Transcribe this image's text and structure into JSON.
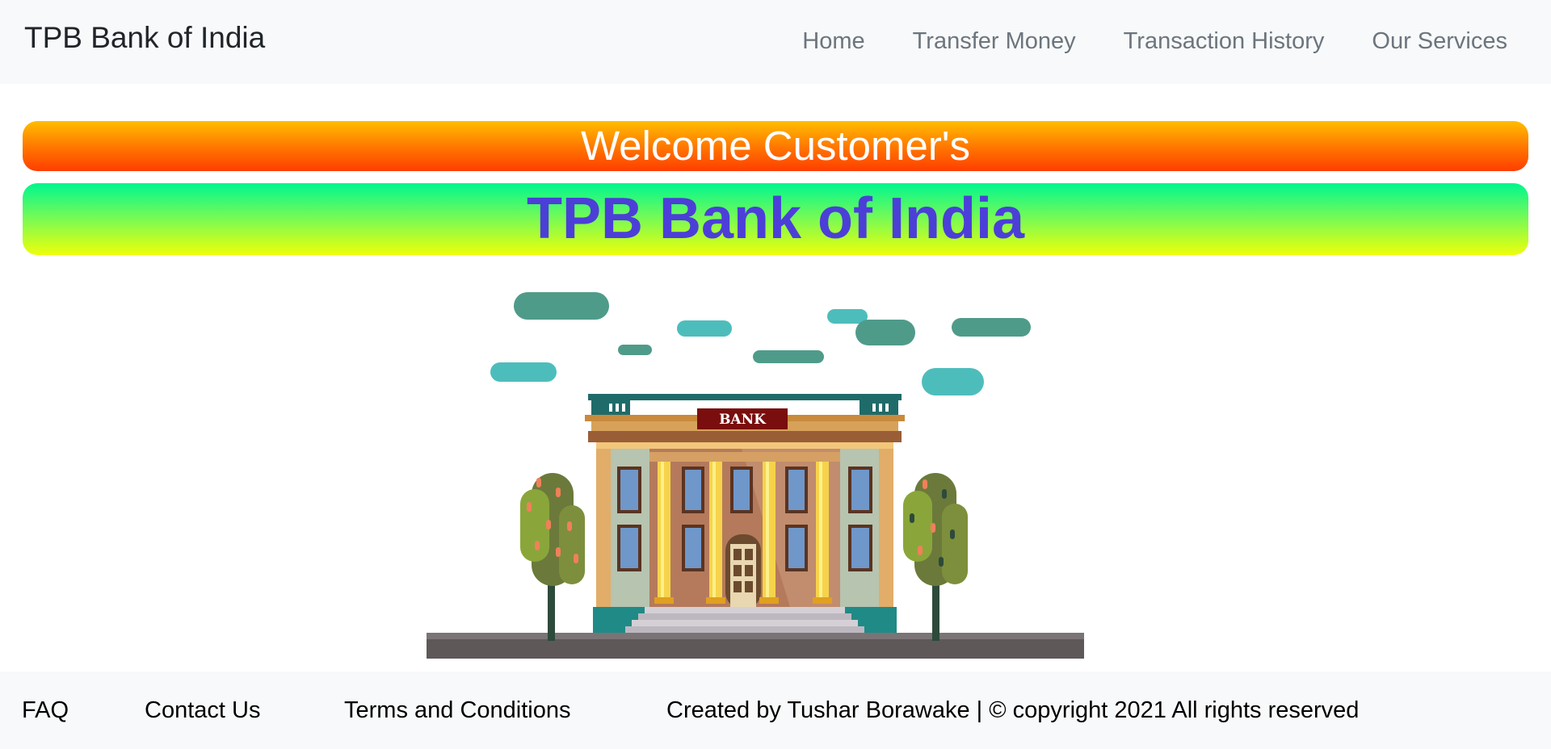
{
  "navbar": {
    "brand": "TPB Bank of India",
    "links": [
      "Home",
      "Transfer Money",
      "Transaction History",
      "Our Services"
    ]
  },
  "hero": {
    "welcome": "Welcome Customer's",
    "bank_name": "TPB Bank of India"
  },
  "illustration": {
    "sign_text": "BANK"
  },
  "footer": {
    "faq": "FAQ",
    "contact": "Contact Us",
    "terms": "Terms and Conditions",
    "credit": "Created by Tushar Borawake | © copyright 2021 All rights reserved"
  },
  "colors": {
    "navbar_bg": "#f8f9fa",
    "nav_link": "#6c757d",
    "bank_title": "#4b3fd8",
    "welcome_gradient_top": "#ffbd00",
    "welcome_gradient_bottom": "#ff3d00",
    "bank_gradient_top": "#00f68f",
    "bank_gradient_bottom": "#eeff0a"
  }
}
